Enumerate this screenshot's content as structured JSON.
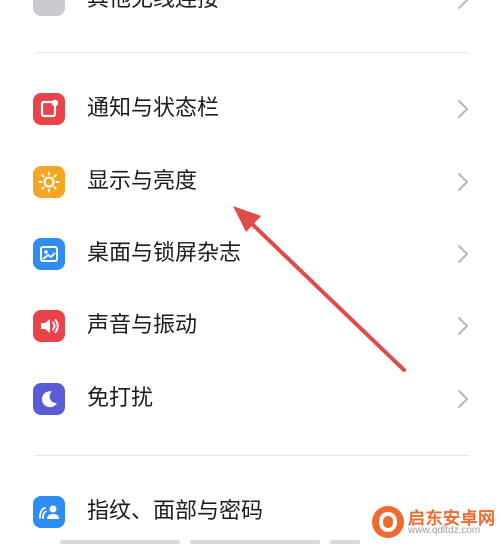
{
  "settings": {
    "items": [
      {
        "label": "其他无线连接",
        "icon": "link-icon",
        "color": "#9aa0a6"
      },
      {
        "label": "通知与状态栏",
        "icon": "notification-icon",
        "color": "#e8434b"
      },
      {
        "label": "显示与亮度",
        "icon": "sun-icon",
        "color": "#f6a623"
      },
      {
        "label": "桌面与锁屏杂志",
        "icon": "image-icon",
        "color": "#2f8cf0"
      },
      {
        "label": "声音与振动",
        "icon": "speaker-icon",
        "color": "#e8434b"
      },
      {
        "label": "免打扰",
        "icon": "moon-icon",
        "color": "#5b5bd6"
      },
      {
        "label": "指纹、面部与密码",
        "icon": "face-lock-icon",
        "color": "#2f8cf0"
      }
    ]
  },
  "watermark": {
    "name": "启东安卓网",
    "url": "www.qdltdz.com",
    "accent": "#ef6a2e"
  },
  "annotation": {
    "arrow_color": "#e04a4a"
  }
}
